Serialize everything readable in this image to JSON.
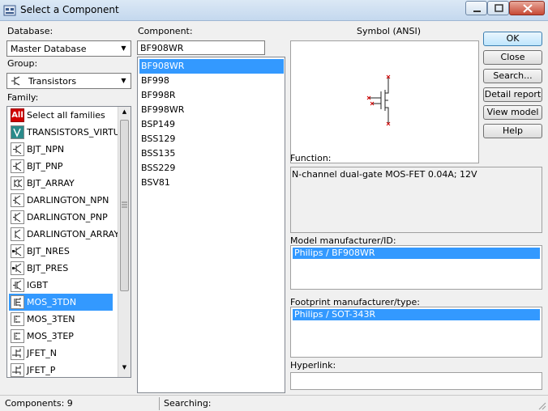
{
  "window": {
    "title": "Select a Component"
  },
  "database": {
    "label": "Database:",
    "value": "Master Database"
  },
  "group": {
    "label": "Group:",
    "value": "Transistors"
  },
  "family": {
    "label": "Family:",
    "items": [
      {
        "label": "Select all families",
        "icon": "all-icon"
      },
      {
        "label": "TRANSISTORS_VIRTUAL",
        "icon": "virtual-transistor-icon"
      },
      {
        "label": "BJT_NPN",
        "icon": "npn-icon"
      },
      {
        "label": "BJT_PNP",
        "icon": "pnp-icon"
      },
      {
        "label": "BJT_ARRAY",
        "icon": "bjt-array-icon"
      },
      {
        "label": "DARLINGTON_NPN",
        "icon": "darlington-npn-icon"
      },
      {
        "label": "DARLINGTON_PNP",
        "icon": "darlington-pnp-icon"
      },
      {
        "label": "DARLINGTON_ARRAY",
        "icon": "darlington-array-icon"
      },
      {
        "label": "BJT_NRES",
        "icon": "bjt-nres-icon"
      },
      {
        "label": "BJT_PRES",
        "icon": "bjt-pres-icon"
      },
      {
        "label": "IGBT",
        "icon": "igbt-icon"
      },
      {
        "label": "MOS_3TDN",
        "icon": "mos-3tdn-icon"
      },
      {
        "label": "MOS_3TEN",
        "icon": "mos-3ten-icon"
      },
      {
        "label": "MOS_3TEP",
        "icon": "mos-3tep-icon"
      },
      {
        "label": "JFET_N",
        "icon": "jfet-n-icon"
      },
      {
        "label": "JFET_P",
        "icon": "jfet-p-icon"
      }
    ],
    "selected": "MOS_3TDN"
  },
  "component": {
    "label": "Component:",
    "search_value": "BF908WR",
    "items": [
      "BF908WR",
      "BF998",
      "BF998R",
      "BF998WR",
      "BSP149",
      "BSS129",
      "BSS135",
      "BSS229",
      "BSV81"
    ],
    "selected": "BF908WR"
  },
  "symbol": {
    "label": "Symbol (ANSI)"
  },
  "function": {
    "label": "Function:",
    "text": "N-channel dual-gate MOS-FET 0.04A; 12V"
  },
  "model": {
    "label": "Model manufacturer/ID:",
    "selected": "Philips / BF908WR"
  },
  "footprint": {
    "label": "Footprint manufacturer/type:",
    "selected": "Philips / SOT-343R"
  },
  "hyperlink": {
    "label": "Hyperlink:",
    "value": ""
  },
  "buttons": {
    "ok": "OK",
    "close": "Close",
    "search": "Search...",
    "detail_report": "Detail report",
    "view_model": "View model",
    "help": "Help"
  },
  "status": {
    "components": "Components: 9",
    "searching": "Searching:"
  },
  "colors": {
    "selection": "#3399ff",
    "symbol_red": "#d00000"
  }
}
